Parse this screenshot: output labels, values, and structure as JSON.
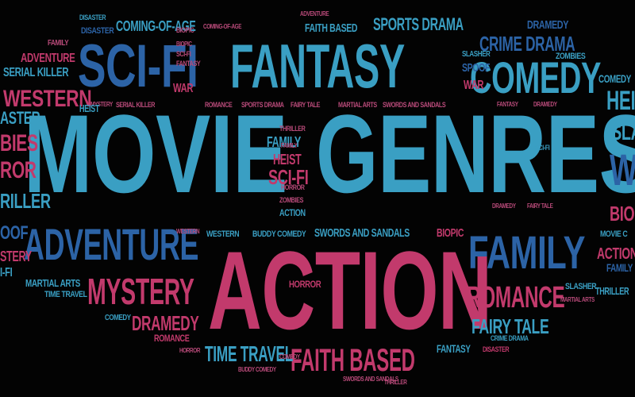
{
  "palette": {
    "background": "#030303",
    "teal": "#3a9fc3",
    "navy": "#2c63a6",
    "pink": "#c23a6c",
    "rose": "#b84a79"
  },
  "big": {
    "movie": "MOVIE",
    "genres": "GENRES",
    "action": "ACTION"
  },
  "large": {
    "scifi": "SCI-FI",
    "fantasy": "FANTASY",
    "comedy": "COMEDY",
    "adventure": "ADVENTURE",
    "family": "FAMILY",
    "mystery": "MYSTERY",
    "romance": "ROMANCE",
    "faith_based": "FAITH BASED",
    "western": "WESTERN",
    "time_travel": "TIME TRAVEL",
    "fairy_tale": "FAIRY TALE",
    "dramedy": "DRAMEDY",
    "crime_drama": "CRIME DRAMA",
    "sports_drama": "SPORTS DRAMA",
    "heist": "HEIST"
  },
  "medium": {
    "coming_of_age": "COMING-OF-AGE",
    "faith_based_top": "FAITH BASED",
    "dramedy_top": "DRAMEDY",
    "disaster": "DISASTER",
    "adventure_left": "ADVENTURE",
    "serial_killer": "SERIAL KILLER",
    "western_left": "WESTERN",
    "family_mid": "FAMILY",
    "heist_mid": "HEIST",
    "scifi_mid": "SCI-FI",
    "swords_sandals": "SWORDS AND SANDALS",
    "biopic": "BIOPIC",
    "martial_arts": "MARTIAL ARTS",
    "war": "WAR",
    "spoof": "SPOOF",
    "zombies": "ZOMBIES",
    "slasher": "SLASHER",
    "fantasy_small": "FANTASY",
    "comedy_right": "COMEDY",
    "thriller": "THRILLER",
    "action_right": "ACTION",
    "biopic_right": "BIOPIC",
    "movie_c": "MOVIE C",
    "horror": "HORROR",
    "western_small": "WESTERN",
    "buddy_comedy": "BUDDY COMEDY"
  },
  "small": {
    "family_tl": "FAMILY",
    "scifi_tiny": "SCI-FI",
    "fantasy_tiny": "FANTASY",
    "biopic_tiny": "BIOPIC",
    "war_tiny": "WAR",
    "serial_killer_tiny": "SERIAL KILLER",
    "mystery_tiny": "MYSTERY",
    "romance_tiny": "ROMANCE",
    "sports_drama_tiny": "SPORTS DRAMA",
    "fairy_tale_tiny": "FAIRY TALE",
    "martial_arts_tiny": "MARTIAL ARTS",
    "swords_tiny": "SWORDS AND SANDALS",
    "heist_tiny": "HEIST",
    "thriller_tiny": "THRILLER",
    "zombies_tiny": "ZOMBIES",
    "action_tiny": "ACTION",
    "time_travel_l": "TIME TRAVEL",
    "comedy_l": "COMEDY",
    "romance_l": "ROMANCE",
    "horror_l": "HORROR",
    "buddy_comedy_tiny": "BUDDY COMEDY",
    "swords_bottom": "SWORDS AND SANDALS",
    "crime_drama_tiny": "CRIME DRAMA",
    "disaster_tiny": "DISASTER",
    "slasher_r": "SLASHER",
    "martial_arts_r": "MARTIAL ARTS",
    "dramedy_r": "DRAMEDY",
    "fairy_tale_r": "FAIRY TALE",
    "scifi_r": "SCI-FI",
    "adventure_top": "ADVENTURE",
    "coming_tiny": "COMING-OF-AGE",
    "disaster_top": "DISASTER",
    "horror_tiny": "HORROR",
    "thriller_tiny2": "THRILLER",
    "western_tiny": "WESTERN",
    "biopic_tiny2": "BIOPIC",
    "family_tiny": "FAMILY",
    "comedy_tiny": "COMEDY",
    "fantasy_tiny2": "FANTASY",
    "dramedy_tiny": "DRAMEDY"
  },
  "edge_fragments": {
    "left_1": "ASTER",
    "left_2": "BIES",
    "left_3": "ROR",
    "left_4": "RILLER",
    "left_5": "OOF",
    "left_6": "STERY",
    "left_7": "I-FI",
    "right_1": "HEI",
    "right_2": "SLAS",
    "right_3": "BIO",
    "right_4": "W",
    "right_5": "FAMILY"
  }
}
